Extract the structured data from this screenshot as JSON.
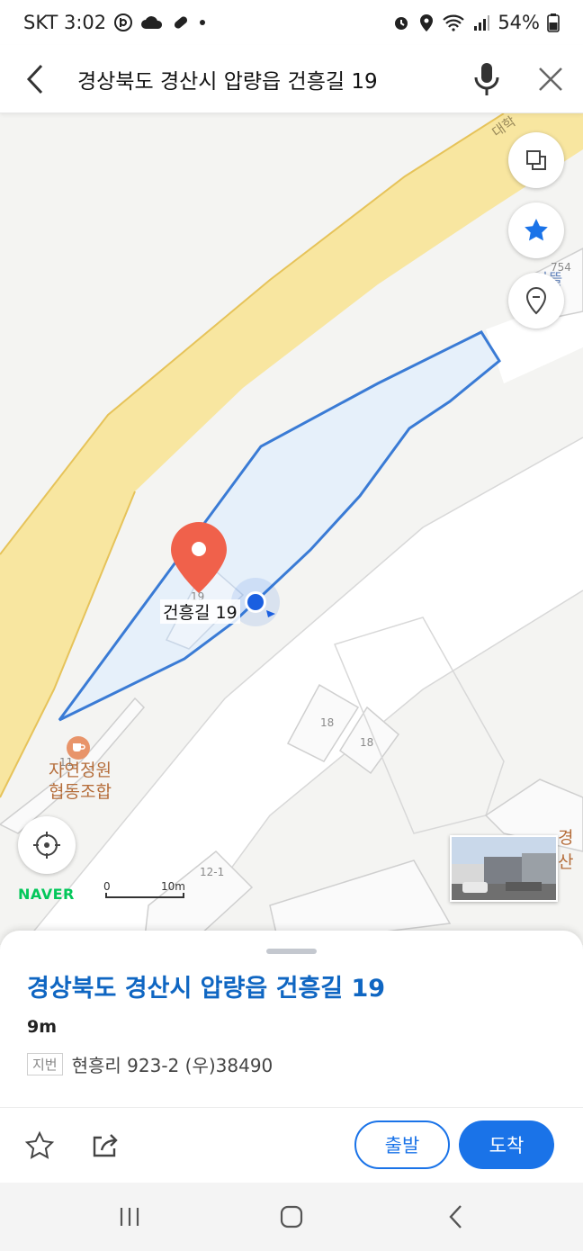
{
  "status_bar": {
    "carrier_time": "SKT 3:02",
    "battery": "54%"
  },
  "search": {
    "query": "경상북도 경산시 압량읍 건흥길 19"
  },
  "map": {
    "place_label": "건흥길 19",
    "lot_numbers": {
      "pin_lot": "19",
      "top_right_lot": "754",
      "lot_18a": "18",
      "lot_18b": "18",
      "lot_11": "11",
      "lot_12_1": "12-1"
    },
    "road_label_partial": "대학",
    "building_label_partial": "아뜰",
    "poi": {
      "name": "자연정원 협동조합",
      "icon": "cafe-icon"
    },
    "right_edge_label": "경산",
    "logo": "NAVER",
    "scale": {
      "start": "0",
      "end": "10m"
    },
    "colors": {
      "parcel_stroke": "#3a7bd5",
      "parcel_fill": "#e6f0fa",
      "main_road": "#f8e6a0",
      "pin": "#f0614b",
      "location_dot": "#1a5fe0"
    },
    "buttons": [
      "layers-icon",
      "favorites-star-icon",
      "location-pin-icon",
      "current-location-icon"
    ]
  },
  "result": {
    "title": "경상북도 경산시 압량읍 건흥길 19",
    "distance": "9m",
    "jibun_tag": "지번",
    "jibun_text": "현흥리 923-2 (우)38490",
    "actions": {
      "start": "출발",
      "arrive": "도착"
    },
    "accent_color": "#1a73e8"
  }
}
